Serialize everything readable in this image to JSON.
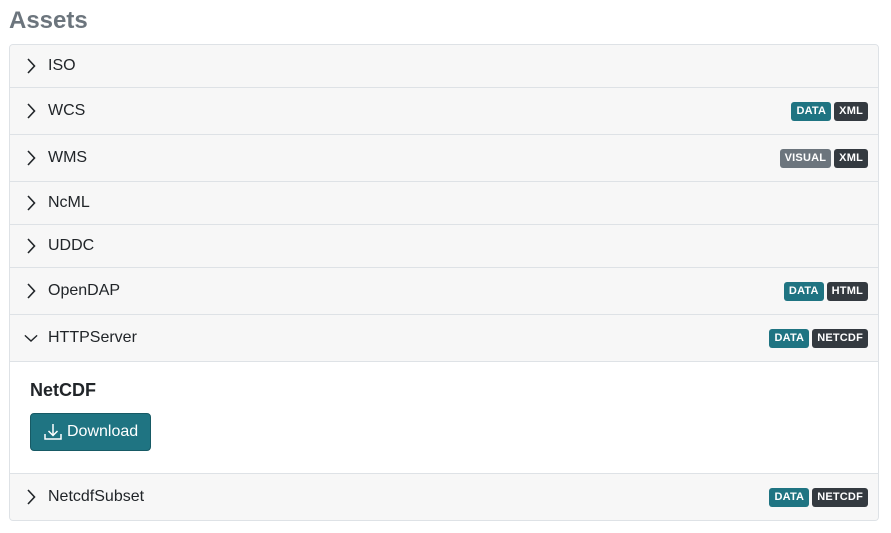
{
  "title": "Assets",
  "items": [
    {
      "label": "ISO",
      "badges": []
    },
    {
      "label": "WCS",
      "badges": [
        {
          "text": "DATA",
          "kind": "data"
        },
        {
          "text": "XML",
          "kind": "fmt"
        }
      ]
    },
    {
      "label": "WMS",
      "badges": [
        {
          "text": "VISUAL",
          "kind": "visual"
        },
        {
          "text": "XML",
          "kind": "fmt"
        }
      ]
    },
    {
      "label": "NcML",
      "badges": []
    },
    {
      "label": "UDDC",
      "badges": []
    },
    {
      "label": "OpenDAP",
      "badges": [
        {
          "text": "DATA",
          "kind": "data"
        },
        {
          "text": "HTML",
          "kind": "fmt"
        }
      ]
    },
    {
      "label": "HTTPServer",
      "badges": [
        {
          "text": "DATA",
          "kind": "data"
        },
        {
          "text": "NETCDF",
          "kind": "fmt"
        }
      ],
      "expanded": true
    },
    {
      "label": "NetcdfSubset",
      "badges": [
        {
          "text": "DATA",
          "kind": "data"
        },
        {
          "text": "NETCDF",
          "kind": "fmt"
        }
      ]
    }
  ],
  "expanded_body": {
    "title": "NetCDF",
    "download_label": "Download",
    "icon": "download-icon"
  },
  "colors": {
    "data_badge": "#1f7482",
    "visual_badge": "#6c757d",
    "format_badge": "#343a40",
    "button": "#1f7482"
  },
  "icons": {
    "collapsed": "chevron-right-icon",
    "expanded": "chevron-down-icon"
  }
}
